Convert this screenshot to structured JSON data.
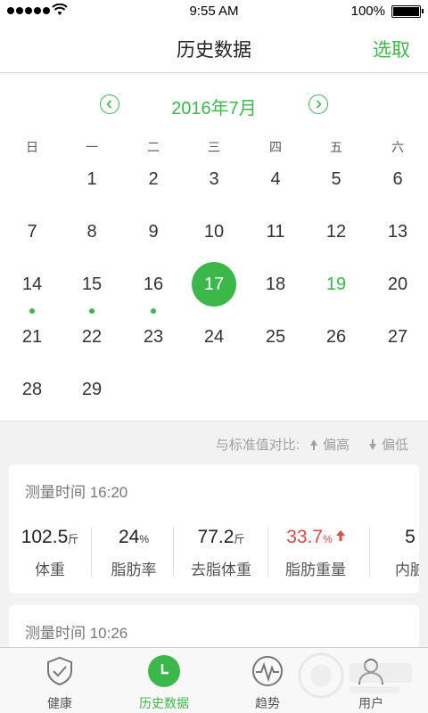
{
  "status_bar": {
    "time": "9:55 AM",
    "battery_pct": "100%"
  },
  "nav": {
    "title": "历史数据",
    "action_label": "选取"
  },
  "calendar": {
    "month_label": "2016年7月",
    "weekdays": [
      "日",
      "一",
      "二",
      "三",
      "四",
      "五",
      "六"
    ],
    "days": [
      "1",
      "2",
      "3",
      "4",
      "5",
      "6",
      "7",
      "8",
      "9",
      "10",
      "11",
      "12",
      "13",
      "14",
      "15",
      "16",
      "17",
      "18",
      "19",
      "20",
      "21",
      "22",
      "23",
      "24",
      "25",
      "26",
      "27",
      "28",
      "29"
    ],
    "selected_day": "17",
    "today": "19",
    "days_with_data": [
      "14",
      "15",
      "16"
    ],
    "first_weekday_index": 1
  },
  "legend": {
    "label": "与标准值对比:",
    "higher": "偏高",
    "lower": "偏低"
  },
  "records": [
    {
      "time": "测量时间 16:20",
      "metrics": [
        {
          "value": "102.5",
          "unit": "斤",
          "label": "体重",
          "alert": false
        },
        {
          "value": "24",
          "unit": "%",
          "label": "脂肪率",
          "alert": false
        },
        {
          "value": "77.2",
          "unit": "斤",
          "label": "去脂体重",
          "alert": false
        },
        {
          "value": "33.7",
          "unit": "%",
          "label": "脂肪重量",
          "alert": true
        },
        {
          "value": "5",
          "unit": "",
          "label": "内脏",
          "alert": false
        }
      ]
    },
    {
      "time": "测量时间 10:26",
      "metrics": []
    }
  ],
  "tabs": [
    {
      "label": "健康",
      "icon": "shield-check-icon",
      "active": false
    },
    {
      "label": "历史数据",
      "icon": "clock-icon",
      "active": true
    },
    {
      "label": "趋势",
      "icon": "pulse-icon",
      "active": false
    },
    {
      "label": "用户",
      "icon": "user-icon",
      "active": false
    }
  ],
  "colors": {
    "accent": "#3cb84b",
    "alert": "#e04747"
  }
}
